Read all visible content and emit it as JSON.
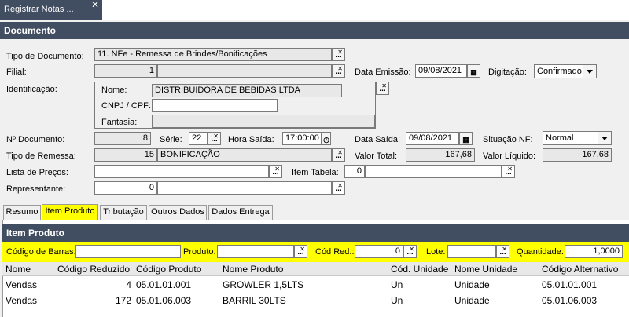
{
  "window_tab": {
    "title": "Registrar Notas ...",
    "close_glyph": "✕"
  },
  "documento": {
    "section_title": "Documento",
    "tipo_documento": {
      "label": "Tipo de Documento:",
      "value": "11. NFe - Remessa de Brindes/Bonificações"
    },
    "filial": {
      "label": "Filial:",
      "code": "1",
      "name": ""
    },
    "data_emissao": {
      "label": "Data Emissão:",
      "value": "09/08/2021"
    },
    "digitacao": {
      "label": "Digitação:",
      "value": "Confirmado"
    },
    "identificacao": {
      "label": "Identificação:",
      "nome_label": "Nome:",
      "nome_value": "DISTRIBUIDORA DE BEBIDAS LTDA",
      "cnpj_label": "CNPJ / CPF:",
      "cnpj_value": "",
      "fantasia_label": "Fantasia:",
      "fantasia_value": ""
    },
    "n_documento": {
      "label": "Nº Documento:",
      "value": "8"
    },
    "serie": {
      "label": "Série:",
      "value": "22"
    },
    "hora_saida": {
      "label": "Hora Saída:",
      "value": "17:00:00"
    },
    "data_saida": {
      "label": "Data Saída:",
      "value": "09/08/2021"
    },
    "situacao_nf": {
      "label": "Situação NF:",
      "value": "Normal"
    },
    "tipo_remessa": {
      "label": "Tipo de Remessa:",
      "code": "15",
      "name": "BONIFICAÇÃO"
    },
    "valor_total": {
      "label": "Valor Total:",
      "value": "167,68"
    },
    "valor_liquido": {
      "label": "Valor Líquido:",
      "value": "167,68"
    },
    "lista_precos": {
      "label": "Lista de Preços:",
      "value": ""
    },
    "item_tabela": {
      "label": "Item Tabela:",
      "code": "0",
      "name": ""
    },
    "representante": {
      "label": "Representante:",
      "code": "0",
      "name": ""
    }
  },
  "subtabs": [
    "Resumo",
    "Item Produto",
    "Tributação",
    "Outros Dados",
    "Dados Entrega"
  ],
  "item_produto": {
    "section_title": "Item Produto",
    "codigo_barras_label": "Código de Barras:",
    "produto_label": "Produto:",
    "cod_red_label": "Cód Red.:",
    "cod_red_value": "0",
    "lote_label": "Lote:",
    "quantidade_label": "Quantidade:",
    "quantidade_value": "1,0000"
  },
  "grid": {
    "columns": [
      "Nome",
      "Código Reduzido",
      "Código Produto",
      "Nome Produto",
      "Cód. Unidade",
      "Nome Unidade",
      "Código Alternativo"
    ],
    "rows": [
      [
        "Vendas",
        "4",
        "05.01.01.001",
        "GROWLER 1,5LTS",
        "Un",
        "Unidade",
        "05.01.01.001"
      ],
      [
        "Vendas",
        "172",
        "05.01.06.003",
        "BARRIL 30LTS",
        "Un",
        "Unidade",
        "05.01.06.003"
      ]
    ]
  },
  "button_glyph": "...",
  "colors": {
    "header_bg": "#414d60",
    "highlight": "#ffff00"
  }
}
